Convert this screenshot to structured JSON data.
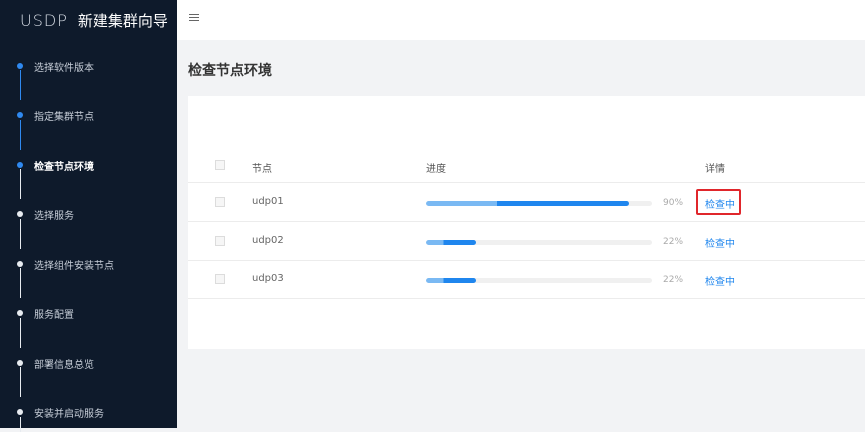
{
  "sidebar": {
    "logo": "USDP",
    "title": "新建集群向导",
    "steps": [
      {
        "label": "选择软件版本",
        "state": "done"
      },
      {
        "label": "指定集群节点",
        "state": "done"
      },
      {
        "label": "检查节点环境",
        "state": "active"
      },
      {
        "label": "选择服务",
        "state": "pending"
      },
      {
        "label": "选择组件安装节点",
        "state": "pending"
      },
      {
        "label": "服务配置",
        "state": "pending"
      },
      {
        "label": "部署信息总览",
        "state": "pending"
      },
      {
        "label": "安装并启动服务",
        "state": "pending"
      }
    ]
  },
  "page": {
    "title": "检查节点环境"
  },
  "table": {
    "headers": {
      "node": "节点",
      "progress": "进度",
      "detail": "详情"
    },
    "rows": [
      {
        "node": "udp01",
        "progress": 90,
        "progress_label": "90%",
        "detail": "检查中",
        "highlighted": true
      },
      {
        "node": "udp02",
        "progress": 22,
        "progress_label": "22%",
        "detail": "检查中",
        "highlighted": false
      },
      {
        "node": "udp03",
        "progress": 22,
        "progress_label": "22%",
        "detail": "检查中",
        "highlighted": false
      }
    ]
  },
  "colors": {
    "sidebar_bg": "#0e1a2b",
    "accent": "#1f86ee",
    "highlight_border": "#e0262b"
  }
}
